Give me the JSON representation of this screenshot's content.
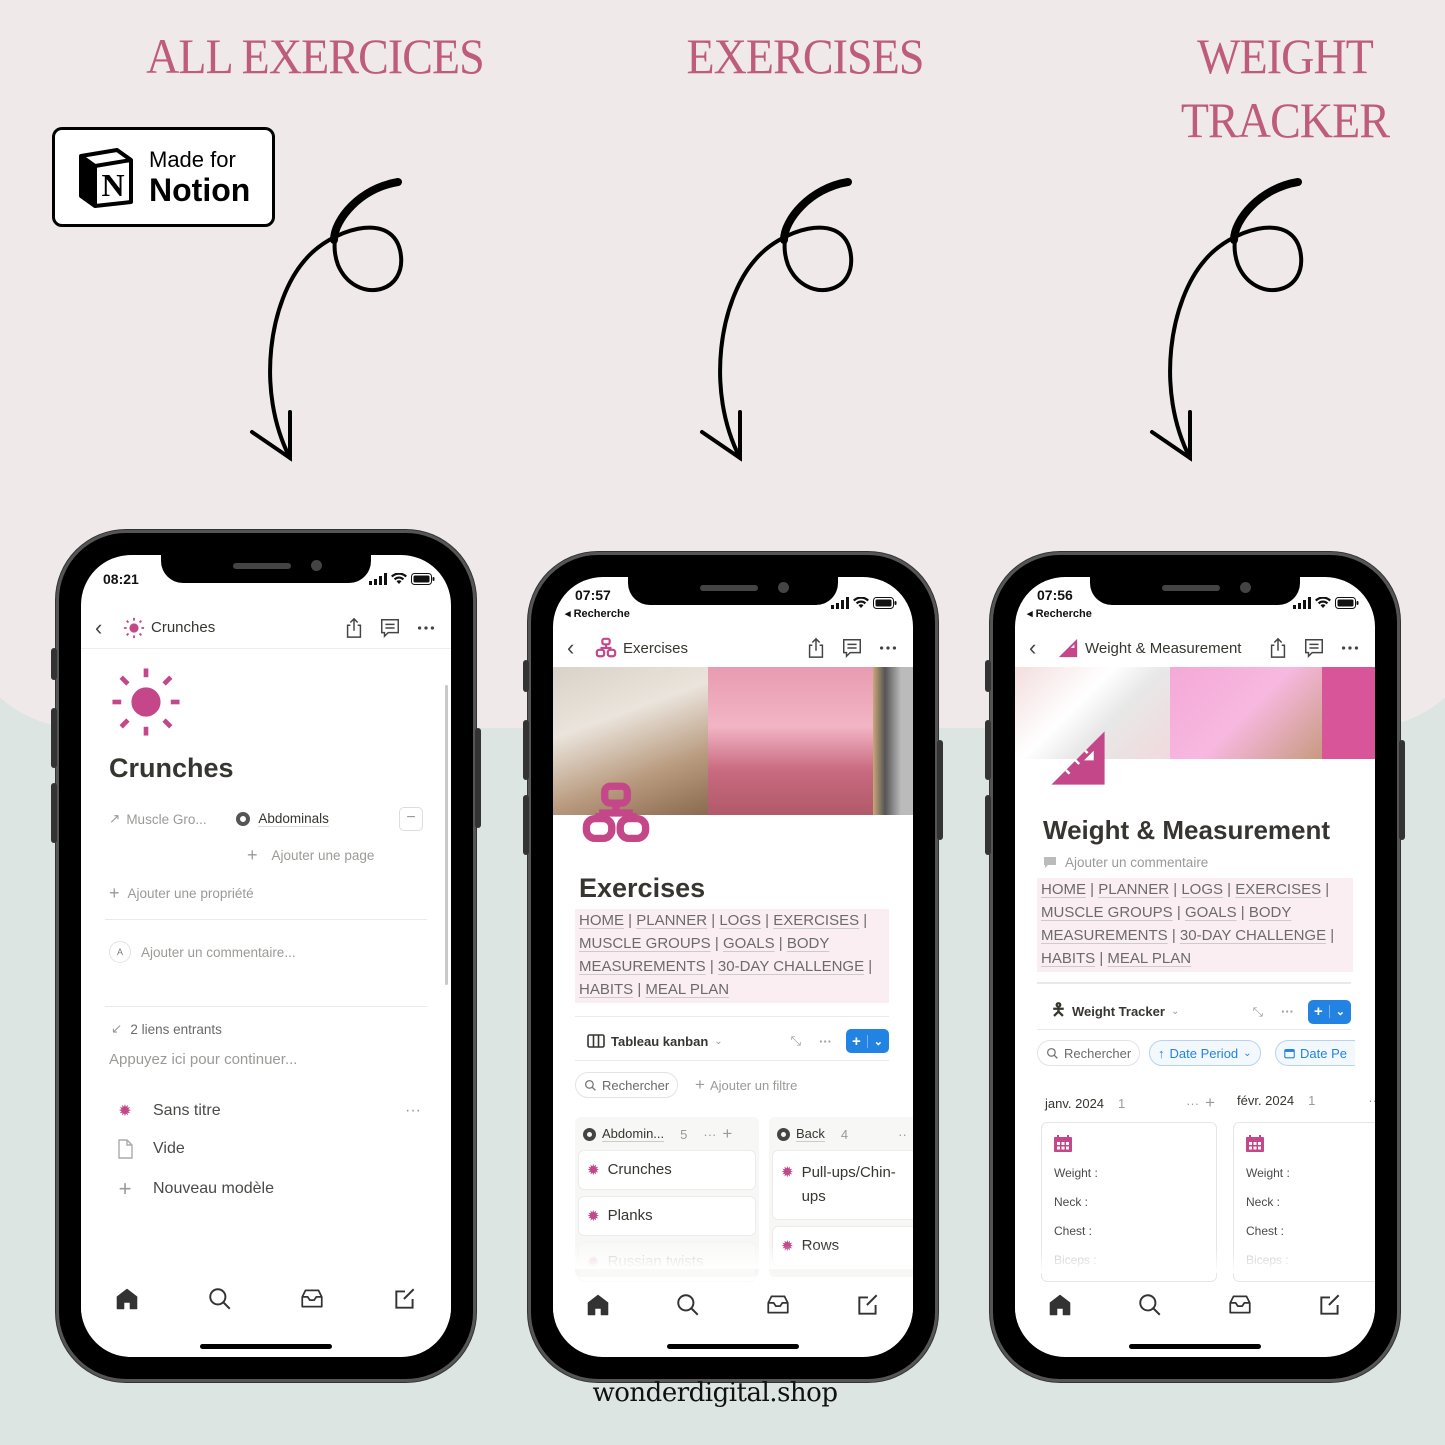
{
  "headings": {
    "left": "ALL EXERCICES",
    "center": "EXERCISES",
    "right_line1": "WEIGHT",
    "right_line2": "TRACKER"
  },
  "badge": {
    "line1": "Made for",
    "line2": "Notion",
    "logo_letter": "N"
  },
  "footer": {
    "site": "wonderdigital.shop"
  },
  "colors": {
    "heading": "#be5c7b",
    "accent_pink": "#c4478a",
    "notion_blue": "#2383e2",
    "bg_top": "#efe9ea",
    "bg_bottom": "#dce5e2"
  },
  "phone1": {
    "time": "08:21",
    "nav_title": "Crunches",
    "page_title": "Crunches",
    "property_label": "Muscle Gro...",
    "property_value": "Abdominals",
    "add_page": "Ajouter une page",
    "add_property": "Ajouter une propriété",
    "comment_avatar": "A",
    "comment_placeholder": "Ajouter un commentaire...",
    "backlinks": "2 liens entrants",
    "continue_hint": "Appuyez ici pour continuer...",
    "templates": [
      {
        "icon": "sun-icon",
        "label": "Sans titre"
      },
      {
        "icon": "page-icon",
        "label": "Vide"
      },
      {
        "icon": "plus-icon",
        "label": "Nouveau modèle"
      }
    ]
  },
  "phone2": {
    "time": "07:57",
    "back_app": "◂ Recherche",
    "nav_title": "Exercises",
    "page_title": "Exercises",
    "nav_links": [
      "HOME",
      "PLANNER",
      "LOGS",
      "EXERCISES",
      "MUSCLE GROUPS",
      "GOALS",
      "BODY MEASUREMENTS",
      "30-DAY CHALLENGE",
      "HABITS",
      "MEAL PLAN"
    ],
    "view_name": "Tableau kanban",
    "search": "Rechercher",
    "add_filter": "Ajouter un filtre",
    "columns": [
      {
        "name": "Abdomin...",
        "count": "5",
        "cards": [
          "Crunches",
          "Planks",
          "Russian twists"
        ]
      },
      {
        "name": "Back",
        "count": "4",
        "cards": [
          "Pull-ups/Chin-ups",
          "Rows"
        ]
      }
    ]
  },
  "phone3": {
    "time": "07:56",
    "back_app": "◂ Recherche",
    "nav_title": "Weight & Measurement",
    "page_title": "Weight & Measurement",
    "add_comment": "Ajouter un commentaire",
    "nav_links": [
      "HOME",
      "PLANNER",
      "LOGS",
      "EXERCISES",
      "MUSCLE GROUPS",
      "GOALS",
      "BODY MEASUREMENTS",
      "30-DAY CHALLENGE",
      "HABITS",
      "MEAL PLAN"
    ],
    "view_name": "Weight Tracker",
    "search": "Rechercher",
    "sort_chip": "Date Period",
    "filter_chip": "Date Pe",
    "columns": [
      {
        "name": "janv. 2024",
        "count": "1",
        "fields": [
          "Weight :",
          "Neck :",
          "Chest :",
          "Biceps :"
        ]
      },
      {
        "name": "févr. 2024",
        "count": "1",
        "fields": [
          "Weight :",
          "Neck :",
          "Chest :",
          "Biceps :"
        ]
      }
    ]
  }
}
